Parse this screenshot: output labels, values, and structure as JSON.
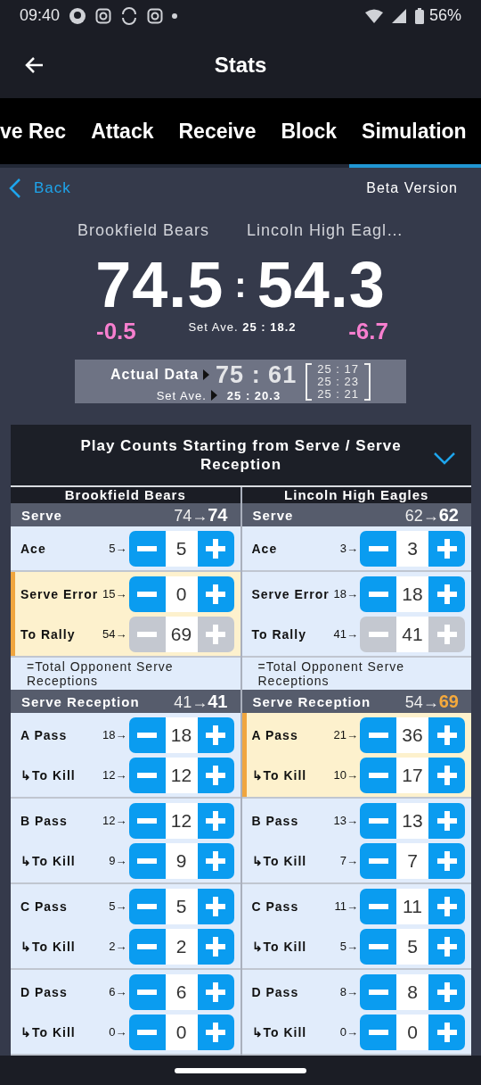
{
  "status_bar": {
    "time": "09:40",
    "battery": "56%"
  },
  "app_bar": {
    "title": "Stats"
  },
  "tabs": [
    {
      "label": "ve Rec",
      "selected": false
    },
    {
      "label": "Attack",
      "selected": false
    },
    {
      "label": "Receive",
      "selected": false
    },
    {
      "label": "Block",
      "selected": false
    },
    {
      "label": "Simulation",
      "selected": true
    }
  ],
  "simulation": {
    "back": "Back",
    "version": "Beta Version",
    "teams": [
      {
        "name": "Brookfield Bears",
        "score": "74.5",
        "diff": "-0.5"
      },
      {
        "name": "Lincoln High Eagl…",
        "score": "54.3",
        "diff": "-6.7"
      }
    ],
    "separator": ":",
    "set_average": "Set Ave. **25 : 18.2**",
    "actual": {
      "label": "Actual Data",
      "score": "75 : 61",
      "set_ave_label": "Set Ave.",
      "set_ave": "25 : 20.3",
      "sets": [
        "25 : 17",
        "25 : 23",
        "25 : 21"
      ]
    }
  },
  "panel": {
    "title": "Play Counts Starting from Serve / Serve Reception",
    "expanded": true,
    "teams": [
      {
        "name": "Brookfield Bears",
        "sections": [
          {
            "title": "Serve",
            "from": "74→",
            "to": "74",
            "changed": false,
            "note": "=Total Opponent Serve Receptions",
            "groups": [
              {
                "highlighted": false,
                "rows": [
                  {
                    "label": "Ace",
                    "prior": "5→",
                    "value": "5",
                    "disabled": false
                  }
                ]
              },
              {
                "highlighted": true,
                "rows": [
                  {
                    "label": "Serve Error",
                    "prior": "15→",
                    "value": "0",
                    "disabled": false
                  },
                  {
                    "label": "To Rally",
                    "prior": "54→",
                    "value": "69",
                    "disabled": true
                  }
                ]
              }
            ]
          },
          {
            "title": "Serve Reception",
            "from": "41→",
            "to": "41",
            "changed": false,
            "groups": [
              {
                "highlighted": false,
                "rows": [
                  {
                    "label": "A Pass",
                    "prior": "18→",
                    "value": "18",
                    "disabled": false
                  },
                  {
                    "label": "↳To Kill",
                    "prior": "12→",
                    "value": "12",
                    "disabled": false
                  }
                ]
              },
              {
                "highlighted": false,
                "rows": [
                  {
                    "label": "B Pass",
                    "prior": "12→",
                    "value": "12",
                    "disabled": false
                  },
                  {
                    "label": "↳To Kill",
                    "prior": "9→",
                    "value": "9",
                    "disabled": false
                  }
                ]
              },
              {
                "highlighted": false,
                "rows": [
                  {
                    "label": "C Pass",
                    "prior": "5→",
                    "value": "5",
                    "disabled": false
                  },
                  {
                    "label": "↳To Kill",
                    "prior": "2→",
                    "value": "2",
                    "disabled": false
                  }
                ]
              },
              {
                "highlighted": false,
                "rows": [
                  {
                    "label": "D Pass",
                    "prior": "6→",
                    "value": "6",
                    "disabled": false
                  },
                  {
                    "label": "↳To Kill",
                    "prior": "0→",
                    "value": "0",
                    "disabled": false
                  }
                ]
              }
            ]
          }
        ]
      },
      {
        "name": "Lincoln High Eagles",
        "sections": [
          {
            "title": "Serve",
            "from": "62→",
            "to": "62",
            "changed": false,
            "note": "=Total Opponent Serve Receptions",
            "groups": [
              {
                "highlighted": false,
                "rows": [
                  {
                    "label": "Ace",
                    "prior": "3→",
                    "value": "3",
                    "disabled": false
                  }
                ]
              },
              {
                "highlighted": false,
                "rows": [
                  {
                    "label": "Serve Error",
                    "prior": "18→",
                    "value": "18",
                    "disabled": false
                  },
                  {
                    "label": "To Rally",
                    "prior": "41→",
                    "value": "41",
                    "disabled": true
                  }
                ]
              }
            ]
          },
          {
            "title": "Serve Reception",
            "from": "54→",
            "to": "69",
            "changed": true,
            "groups": [
              {
                "highlighted": true,
                "rows": [
                  {
                    "label": "A Pass",
                    "prior": "21→",
                    "value": "36",
                    "disabled": false
                  },
                  {
                    "label": "↳To Kill",
                    "prior": "10→",
                    "value": "17",
                    "disabled": false
                  }
                ]
              },
              {
                "highlighted": false,
                "rows": [
                  {
                    "label": "B Pass",
                    "prior": "13→",
                    "value": "13",
                    "disabled": false
                  },
                  {
                    "label": "↳To Kill",
                    "prior": "7→",
                    "value": "7",
                    "disabled": false
                  }
                ]
              },
              {
                "highlighted": false,
                "rows": [
                  {
                    "label": "C Pass",
                    "prior": "11→",
                    "value": "11",
                    "disabled": false
                  },
                  {
                    "label": "↳To Kill",
                    "prior": "5→",
                    "value": "5",
                    "disabled": false
                  }
                ]
              },
              {
                "highlighted": false,
                "rows": [
                  {
                    "label": "D Pass",
                    "prior": "8→",
                    "value": "8",
                    "disabled": false
                  },
                  {
                    "label": "↳To Kill",
                    "prior": "0→",
                    "value": "0",
                    "disabled": false
                  }
                ]
              }
            ]
          }
        ]
      }
    ]
  }
}
